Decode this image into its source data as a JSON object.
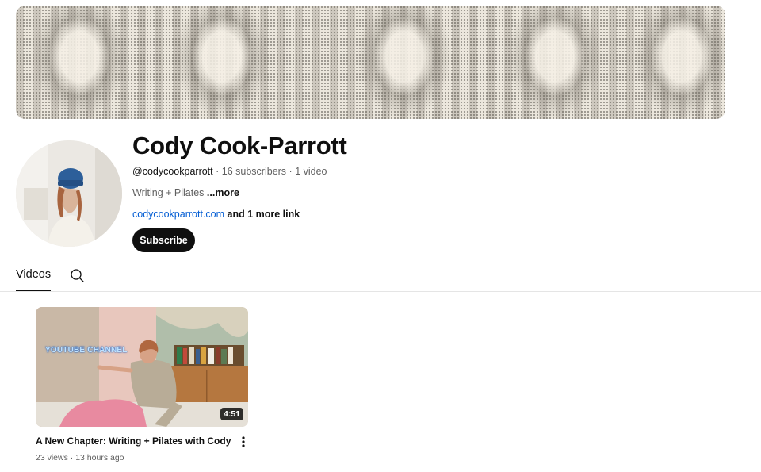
{
  "channel": {
    "name": "Cody Cook-Parrott",
    "handle": "@codycookparrott",
    "separator": "·",
    "subscribers": "16 subscribers",
    "video_count": "1 video",
    "description": "Writing + Pilates",
    "more_label": "...more",
    "link_text": "codycookparrott.com",
    "more_links": "and 1 more link",
    "subscribe_label": "Subscribe"
  },
  "tabs": {
    "videos_label": "Videos",
    "search_icon": "search-icon"
  },
  "videos": [
    {
      "title": "A New Chapter: Writing + Pilates with Cody",
      "views": "23 views",
      "age": "13 hours ago",
      "duration": "4:51",
      "overlay_text": "YOUTUBE CHANNEL",
      "menu_icon": "more-vert-icon"
    }
  ],
  "colors": {
    "accent_link": "#065fd4",
    "button_bg": "#0f0f0f",
    "muted_text": "#606060"
  }
}
